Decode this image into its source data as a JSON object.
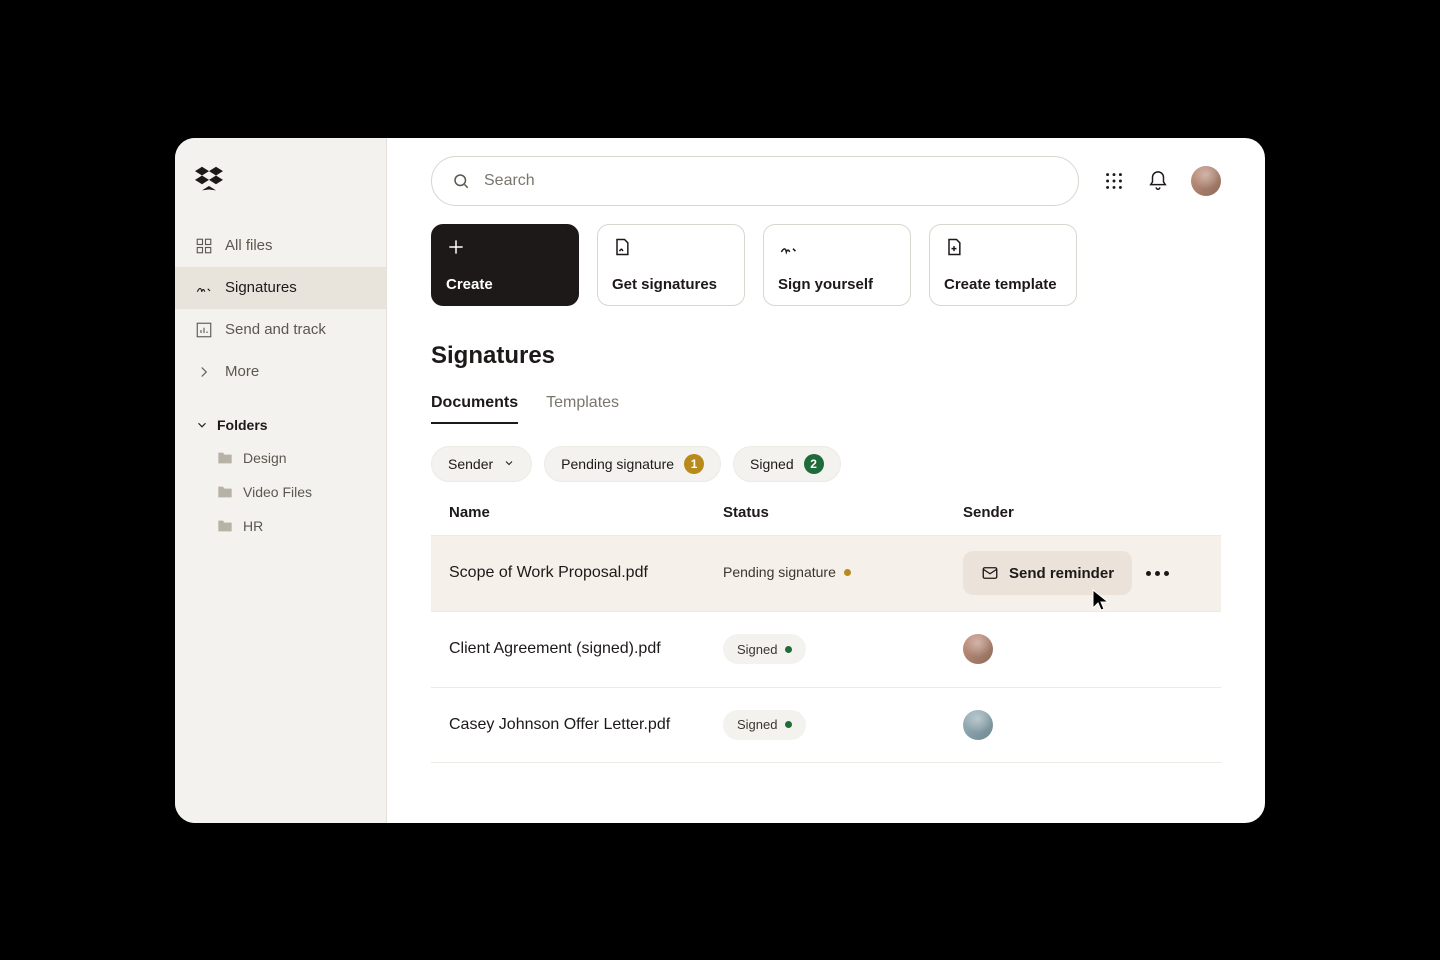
{
  "search": {
    "placeholder": "Search"
  },
  "sidebar": {
    "nav": [
      {
        "label": "All files"
      },
      {
        "label": "Signatures"
      },
      {
        "label": "Send and track"
      },
      {
        "label": "More"
      }
    ],
    "folders_header": "Folders",
    "folders": [
      {
        "label": "Design"
      },
      {
        "label": "Video Files"
      },
      {
        "label": "HR"
      }
    ]
  },
  "actions": {
    "create": "Create",
    "get_signatures": "Get signatures",
    "sign_yourself": "Sign yourself",
    "create_template": "Create template"
  },
  "page_title": "Signatures",
  "tabs": {
    "documents": "Documents",
    "templates": "Templates"
  },
  "filters": {
    "sender": "Sender",
    "pending": "Pending signature",
    "pending_count": "1",
    "signed": "Signed",
    "signed_count": "2"
  },
  "table": {
    "headers": {
      "name": "Name",
      "status": "Status",
      "sender": "Sender"
    },
    "rows": [
      {
        "name": "Scope of Work Proposal.pdf",
        "status_label": "Pending signature",
        "status": "pending",
        "action_label": "Send reminder"
      },
      {
        "name": "Client Agreement (signed).pdf",
        "status_label": "Signed",
        "status": "signed",
        "sender_avatar": "f"
      },
      {
        "name": "Casey Johnson Offer Letter.pdf",
        "status_label": "Signed",
        "status": "signed",
        "sender_avatar": "m"
      }
    ]
  },
  "colors": {
    "pending_badge": "#b88a1c",
    "signed_badge": "#1f6b3a"
  }
}
